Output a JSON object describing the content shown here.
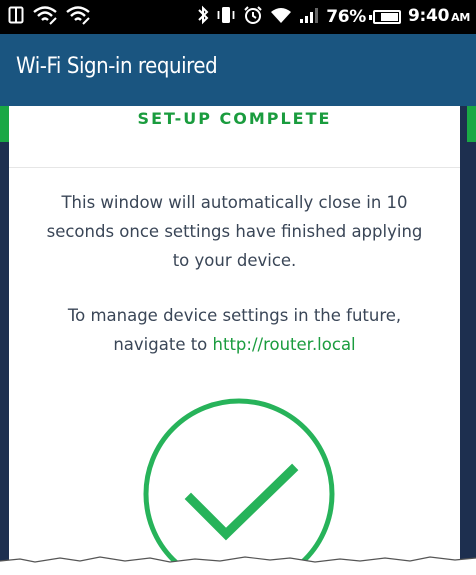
{
  "status_bar": {
    "left_icons": [
      "notification-icon",
      "wifi-icon",
      "wifi-icon"
    ],
    "right_icons": [
      "bluetooth-icon",
      "vibrate-icon",
      "alarm-icon",
      "wifi-signal-icon",
      "cellular-signal-icon"
    ],
    "battery_percent": "76%",
    "battery_level": 0.76,
    "time": "9:40",
    "ampm": "AM"
  },
  "app_bar": {
    "title": "Wi-Fi Sign-in required",
    "background": "#1a5580"
  },
  "page": {
    "heading": "SET-UP COMPLETE",
    "message_1": "This window will automatically close in 10 seconds once settings have finished applying to your device.",
    "message_2_prefix": "To manage device settings in the future, navigate to ",
    "message_2_link": "http://router.local",
    "accent_color": "#1a9c3e",
    "status_icon": "checkmark-circle-icon"
  }
}
